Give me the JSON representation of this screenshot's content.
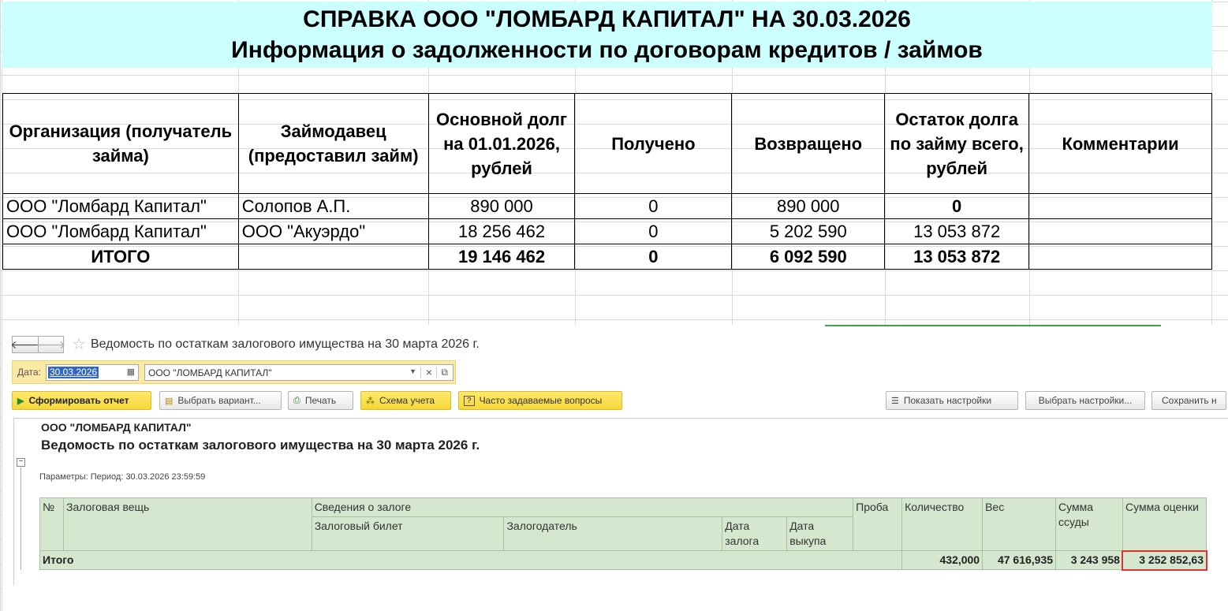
{
  "banner": {
    "line1": "СПРАВКА ООО \"ЛОМБАРД КАПИТАЛ\" НА 30.03.2026",
    "line2": "Информация о задолженности по договорам кредитов / займов"
  },
  "debt_table": {
    "headers": [
      "Организация (получатель займа)",
      "Займодавец (предоставил займ)",
      "Основной долг на 01.01.2026, рублей",
      "Получено",
      "Возвращено",
      "Остаток долга по займу всего, рублей",
      "Комментарии"
    ],
    "rows": [
      [
        "ООО \"Ломбард Капитал\"",
        "Солопов А.П.",
        "890 000",
        "0",
        "890 000",
        "0",
        ""
      ],
      [
        "ООО \"Ломбард Капитал\"",
        "ООО \"Акуэрдо\"",
        "18 256 462",
        "0",
        "5 202 590",
        "13 053 872",
        ""
      ]
    ],
    "total": [
      "ИТОГО",
      "",
      "19 146 462",
      "0",
      "6 092 590",
      "13 053 872",
      ""
    ]
  },
  "window": {
    "title": "Ведомость по остаткам залогового имущества на 30 марта 2026 г.",
    "nav_back": "🡐",
    "nav_forward": "🡒",
    "star": "☆",
    "filter": {
      "date_label": "Дата:",
      "date_value": "30.03.2026",
      "organization_value": "ООО \"ЛОМБАРД КАПИТАЛ\""
    },
    "toolbar": {
      "generate": "Сформировать отчет",
      "choose_variant": "Выбрать вариант...",
      "print": "Печать",
      "accounting_scheme": "Схема учета",
      "faq": "Часто задаваемые вопросы",
      "show_settings": "Показать настройки",
      "choose_settings": "Выбрать настройки...",
      "save": "Сохранить н"
    },
    "report": {
      "organization": "ООО \"ЛОМБАРД КАПИТАЛ\"",
      "title": "Ведомость по остаткам залогового имущества на 30 марта 2026 г.",
      "params": "Параметры:   Период: 30.03.2026 23:59:59",
      "headers": {
        "num": "№",
        "item": "Залоговая вещь",
        "pledge_info": "Сведения о залоге",
        "ticket": "Залоговый билет",
        "pledger": "Залогодатель",
        "pledge_date": "Дата залога",
        "redeem_date": "Дата выкупа",
        "assay": "Проба",
        "quantity": "Количество",
        "weight": "Вес",
        "loan_sum": "Сумма ссуды",
        "valuation_sum": "Сумма оценки"
      },
      "total": {
        "label": "Итого",
        "quantity": "432,000",
        "weight": "47 616,935",
        "loan_sum": "3 243 958",
        "valuation_sum": "3 252 852,63"
      }
    }
  },
  "colors": {
    "banner_bg": "#ccffff",
    "report_cell_bg": "#d6e7cf",
    "filter_bg": "#fbe9a4",
    "highlight": "#e03030"
  }
}
